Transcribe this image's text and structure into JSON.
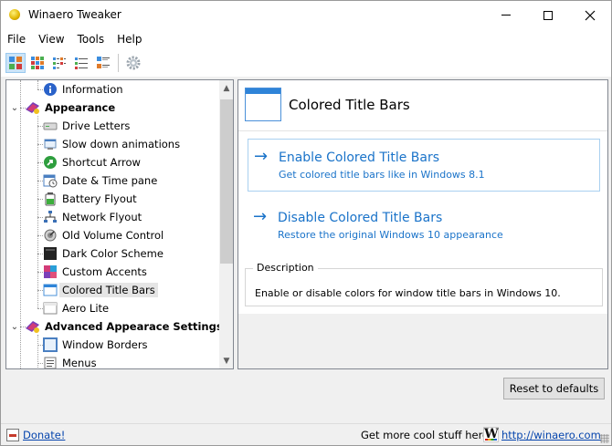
{
  "window": {
    "title": "Winaero Tweaker"
  },
  "menu": [
    "File",
    "View",
    "Tools",
    "Help"
  ],
  "toolbar": {
    "buttons": [
      "view-large-icons",
      "view-small-icons",
      "view-list",
      "view-details",
      "view-tiles",
      "settings"
    ]
  },
  "tree": {
    "rows": [
      {
        "label": "Information",
        "level": 2,
        "icon": "info-icon"
      },
      {
        "label": "Appearance",
        "level": 1,
        "icon": "appearance-icon",
        "category": true
      },
      {
        "label": "Drive Letters",
        "level": 2,
        "icon": "drive-icon"
      },
      {
        "label": "Slow down animations",
        "level": 2,
        "icon": "animation-icon"
      },
      {
        "label": "Shortcut Arrow",
        "level": 2,
        "icon": "shortcut-arrow-icon"
      },
      {
        "label": "Date & Time pane",
        "level": 2,
        "icon": "clock-icon"
      },
      {
        "label": "Battery Flyout",
        "level": 2,
        "icon": "battery-icon"
      },
      {
        "label": "Network Flyout",
        "level": 2,
        "icon": "network-icon"
      },
      {
        "label": "Old Volume Control",
        "level": 2,
        "icon": "volume-icon"
      },
      {
        "label": "Dark Color Scheme",
        "level": 2,
        "icon": "dark-scheme-icon"
      },
      {
        "label": "Custom Accents",
        "level": 2,
        "icon": "accents-icon"
      },
      {
        "label": "Colored Title Bars",
        "level": 2,
        "icon": "title-bar-icon",
        "selected": true
      },
      {
        "label": "Aero Lite",
        "level": 2,
        "icon": "aero-lite-icon"
      },
      {
        "label": "Advanced Appearace Settings",
        "level": 1,
        "icon": "appearance-icon",
        "category": true
      },
      {
        "label": "Window Borders",
        "level": 2,
        "icon": "window-borders-icon"
      },
      {
        "label": "Menus",
        "level": 2,
        "icon": "menus-icon"
      }
    ]
  },
  "page": {
    "title": "Colored Title Bars",
    "actions": [
      {
        "title": "Enable Colored Title Bars",
        "description": "Get colored title bars like in Windows 8.1"
      },
      {
        "title": "Disable Colored Title Bars",
        "description": "Restore the original Windows 10 appearance"
      }
    ],
    "description_legend": "Description",
    "description_text": "Enable or disable colors for window title bars in Windows 10."
  },
  "reset_label": "Reset to defaults",
  "status": {
    "donate_label": "Donate!",
    "more_text": "Get more cool stuff here:",
    "logo_letter": "W",
    "site_link": "http://winaero.com"
  },
  "colors": {
    "accent": "#1a73c9",
    "selection": "#e5e5e5",
    "link": "#0645ad"
  }
}
